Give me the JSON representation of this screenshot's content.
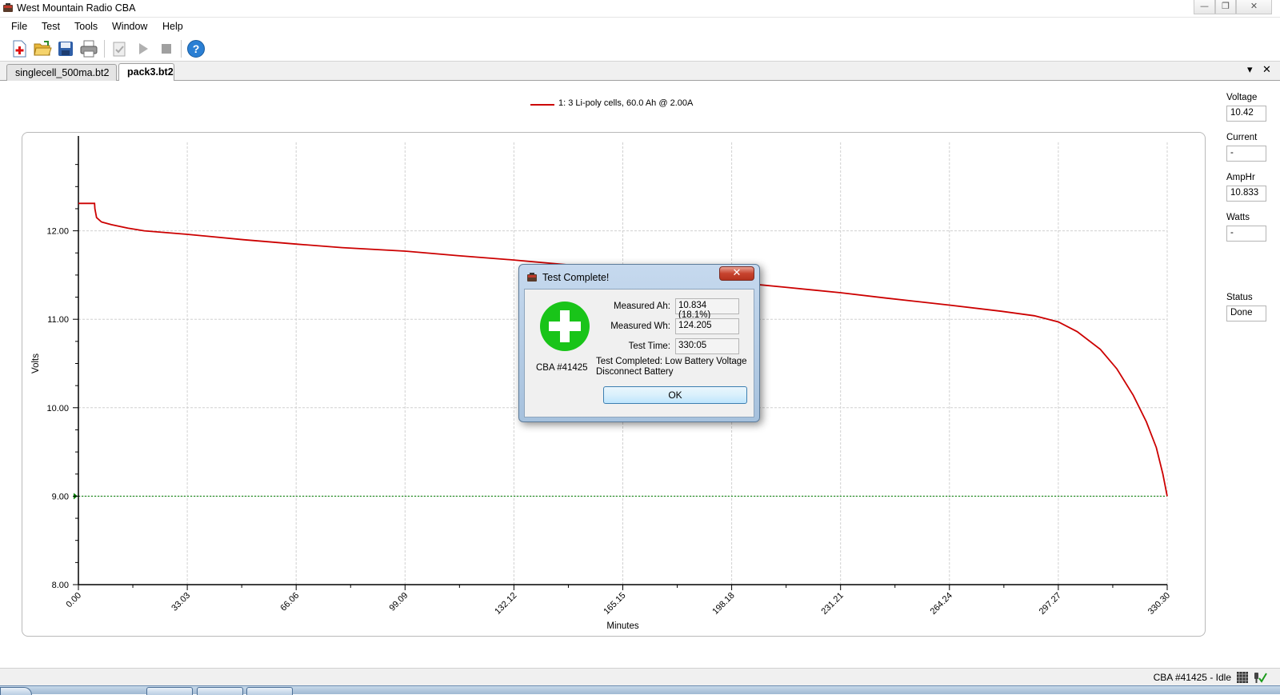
{
  "window": {
    "title": "West Mountain Radio CBA",
    "controls": {
      "minimize": "—",
      "restore": "❐",
      "close": "✕"
    }
  },
  "menu": [
    "File",
    "Test",
    "Tools",
    "Window",
    "Help"
  ],
  "toolbar": {
    "icons": [
      "new-test-icon",
      "open-folder-icon",
      "save-icon",
      "print-icon",
      "checklist-icon",
      "play-icon",
      "stop-icon",
      "help-icon"
    ]
  },
  "tabs": [
    {
      "label": "singlecell_500ma.bt2",
      "active": false
    },
    {
      "label": "pack3.bt2",
      "active": true
    }
  ],
  "tab_controls": {
    "dropdown": "▾",
    "close": "✕"
  },
  "side_panel": {
    "voltage": {
      "label": "Voltage",
      "value": "10.42"
    },
    "current": {
      "label": "Current",
      "value": "-"
    },
    "amphr": {
      "label": "AmpHr",
      "value": "10.833"
    },
    "watts": {
      "label": "Watts",
      "value": "-"
    },
    "status": {
      "label": "Status",
      "value": "Done"
    }
  },
  "chart_data": {
    "type": "line",
    "legend": "1: 3 Li-poly cells, 60.0 Ah @ 2.00A",
    "xlabel": "Minutes",
    "ylabel": "Volts",
    "xlim": [
      0,
      330.3
    ],
    "ylim": [
      8.0,
      13.0
    ],
    "x_ticks": [
      "0.00",
      "33.03",
      "66.06",
      "99.09",
      "132.12",
      "165.15",
      "198.18",
      "231.21",
      "264.24",
      "297.27",
      "330.30"
    ],
    "y_ticks": [
      "8.00",
      "9.00",
      "10.00",
      "11.00",
      "12.00"
    ],
    "grid": true,
    "cutoff_line": {
      "y": 9.0,
      "color": "#008000",
      "style": "dashed"
    },
    "series": [
      {
        "color": "#cc0000",
        "x": [
          0,
          4.9,
          5.0,
          5.5,
          7,
          10,
          15,
          20,
          33.03,
          50,
          66.06,
          80,
          99.09,
          115,
          132.12,
          150,
          165.15,
          180,
          198.18,
          215,
          231.21,
          245,
          264.24,
          280,
          290,
          297.27,
          303,
          310,
          315,
          320,
          324,
          327,
          329,
          330.3
        ],
        "y": [
          12.31,
          12.31,
          12.25,
          12.15,
          12.1,
          12.07,
          12.03,
          12.0,
          11.96,
          11.9,
          11.85,
          11.81,
          11.77,
          11.72,
          11.67,
          11.61,
          11.55,
          11.49,
          11.42,
          11.36,
          11.3,
          11.24,
          11.16,
          11.09,
          11.04,
          10.97,
          10.86,
          10.66,
          10.44,
          10.14,
          9.84,
          9.55,
          9.25,
          9.0
        ]
      }
    ]
  },
  "dialog": {
    "title": "Test Complete!",
    "close": "✕",
    "device": "CBA #41425",
    "measured_ah": {
      "label": "Measured Ah:",
      "value": "10.834 (18.1%)"
    },
    "measured_wh": {
      "label": "Measured Wh:",
      "value": "124.205"
    },
    "test_time": {
      "label": "Test Time:",
      "value": "330:05"
    },
    "message_line1": "Test Completed: Low Battery Voltage",
    "message_line2": "Disconnect Battery",
    "ok_label": "OK",
    "accent": "#19c419"
  },
  "statusbar": {
    "text": "CBA #41425 - Idle"
  }
}
